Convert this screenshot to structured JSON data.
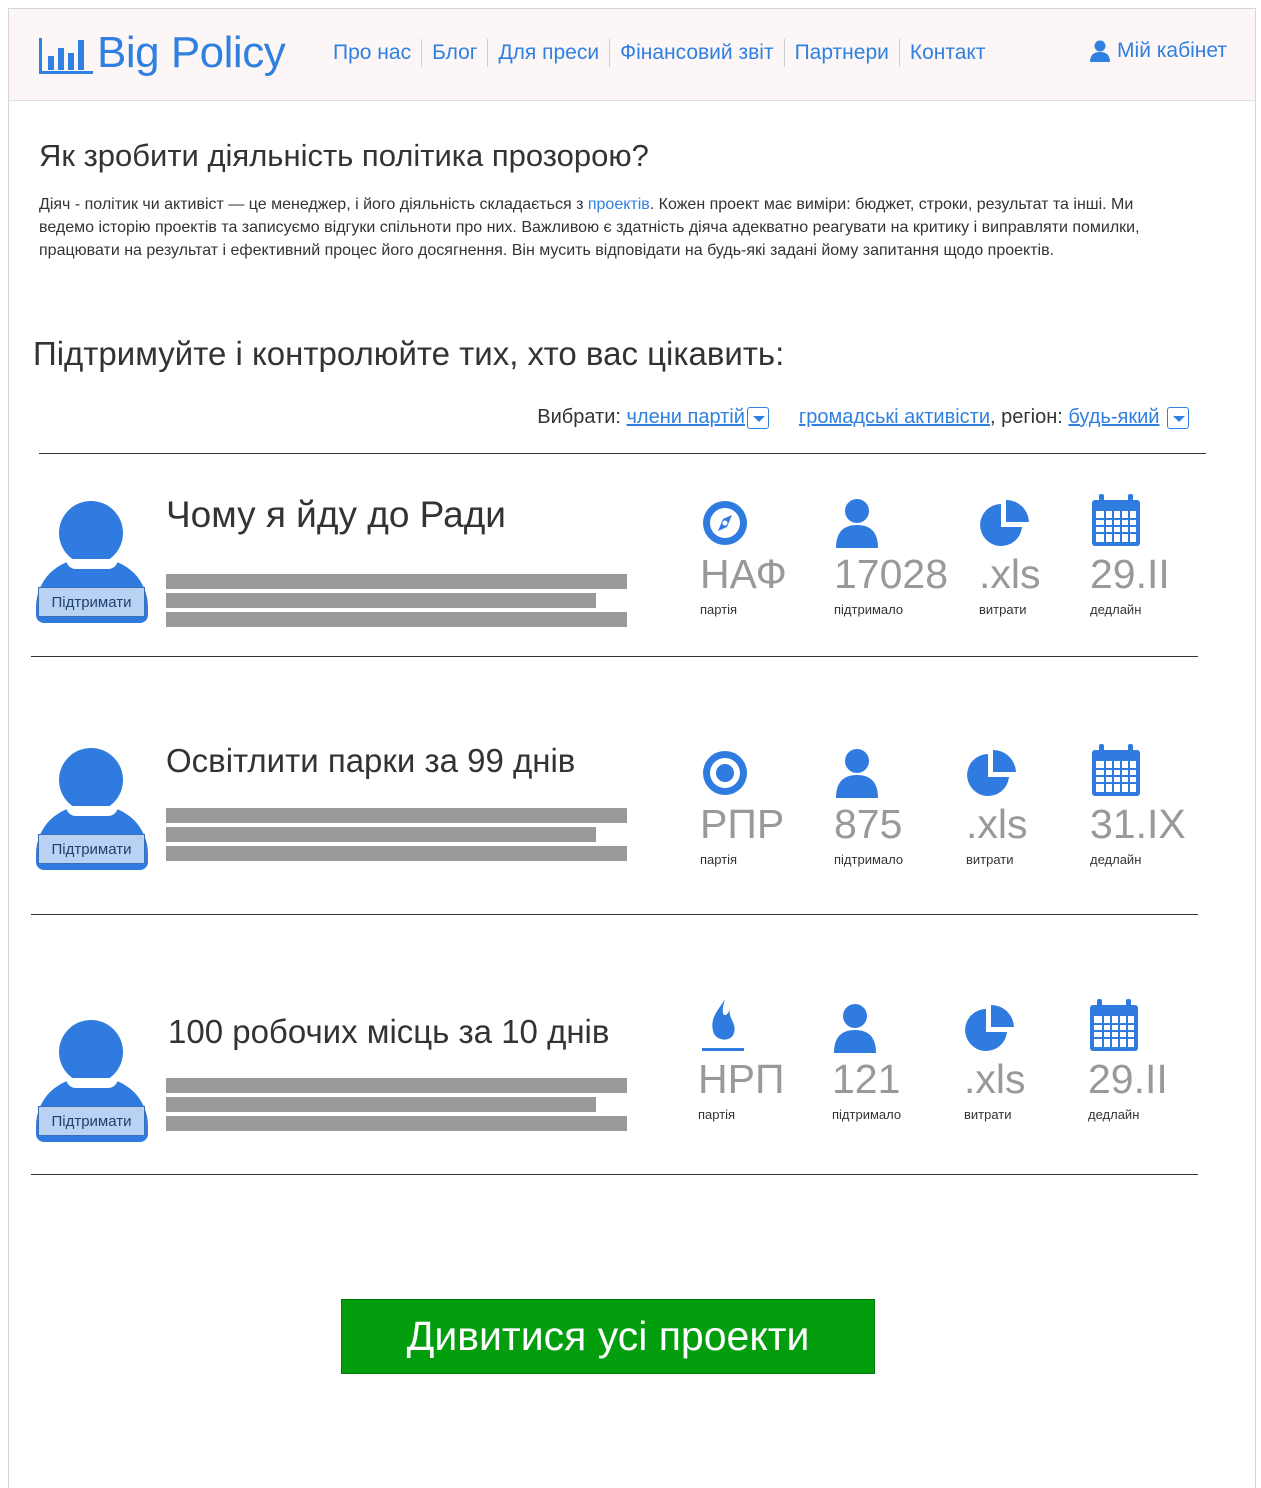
{
  "header": {
    "logo_text": "Big Policy",
    "nav": [
      "Про нас",
      "Блог",
      "Для преси",
      "Фінансовий звіт",
      "Партнери",
      "Контакт"
    ],
    "cabinet_label": "Мій кабінет"
  },
  "intro": {
    "title": "Як зробити діяльність політика прозорою?",
    "text_before_link": "Діяч - політик чи активіст — це менеджер, і його діяльність складається з ",
    "link": "проектів",
    "text_after_link": ". Кожен проект має виміри: бюджет, строки, результат та інші. Ми ведемо історію проектів та записуємо відгуки спільноти про них. Важливою є здатність діяча адекватно реагувати на критику і виправляти помилки, працювати на результат і ефективний процес його досягнення. Він мусить відповідати на будь-які задані йому запитання щодо проектів."
  },
  "support": {
    "title": "Підтримуйте і контролюйте тих, хто вас цікавить:",
    "filter": {
      "label": "Вибрати:",
      "option1": "члени партій",
      "option2": "громадські активісти",
      "region_label": ", регіон:",
      "region_value": "будь-який"
    }
  },
  "projects": [
    {
      "title": "Чому я йду до Ради",
      "support_label": "Підтримати",
      "party": "НАФ",
      "party_label": "партія",
      "party_icon": "compass-icon",
      "supporters": "17028",
      "supporters_label": "підтримало",
      "costs": ".xls",
      "costs_label": "витрати",
      "deadline": "29.II",
      "deadline_label": "дедлайн"
    },
    {
      "title": "Освітлити парки за 99 днів",
      "support_label": "Підтримати",
      "party": "РПР",
      "party_label": "партія",
      "party_icon": "target-icon",
      "supporters": "875",
      "supporters_label": "підтримало",
      "costs": ".xls",
      "costs_label": "витрати",
      "deadline": "31.IX",
      "deadline_label": "дедлайн"
    },
    {
      "title": "100 робочих місць за 10 днів",
      "support_label": "Підтримати",
      "party": "НРП",
      "party_label": "партія",
      "party_icon": "flame-icon",
      "supporters": "121",
      "supporters_label": "підтримало",
      "costs": ".xls",
      "costs_label": "витрати",
      "deadline": "29.II",
      "deadline_label": "дедлайн"
    }
  ],
  "cta_label": "Дивитися усі проекти",
  "colors": {
    "accent": "#2f80e0",
    "icon": "#2f7be0",
    "cta": "#039e0e",
    "bars": "#999999"
  }
}
